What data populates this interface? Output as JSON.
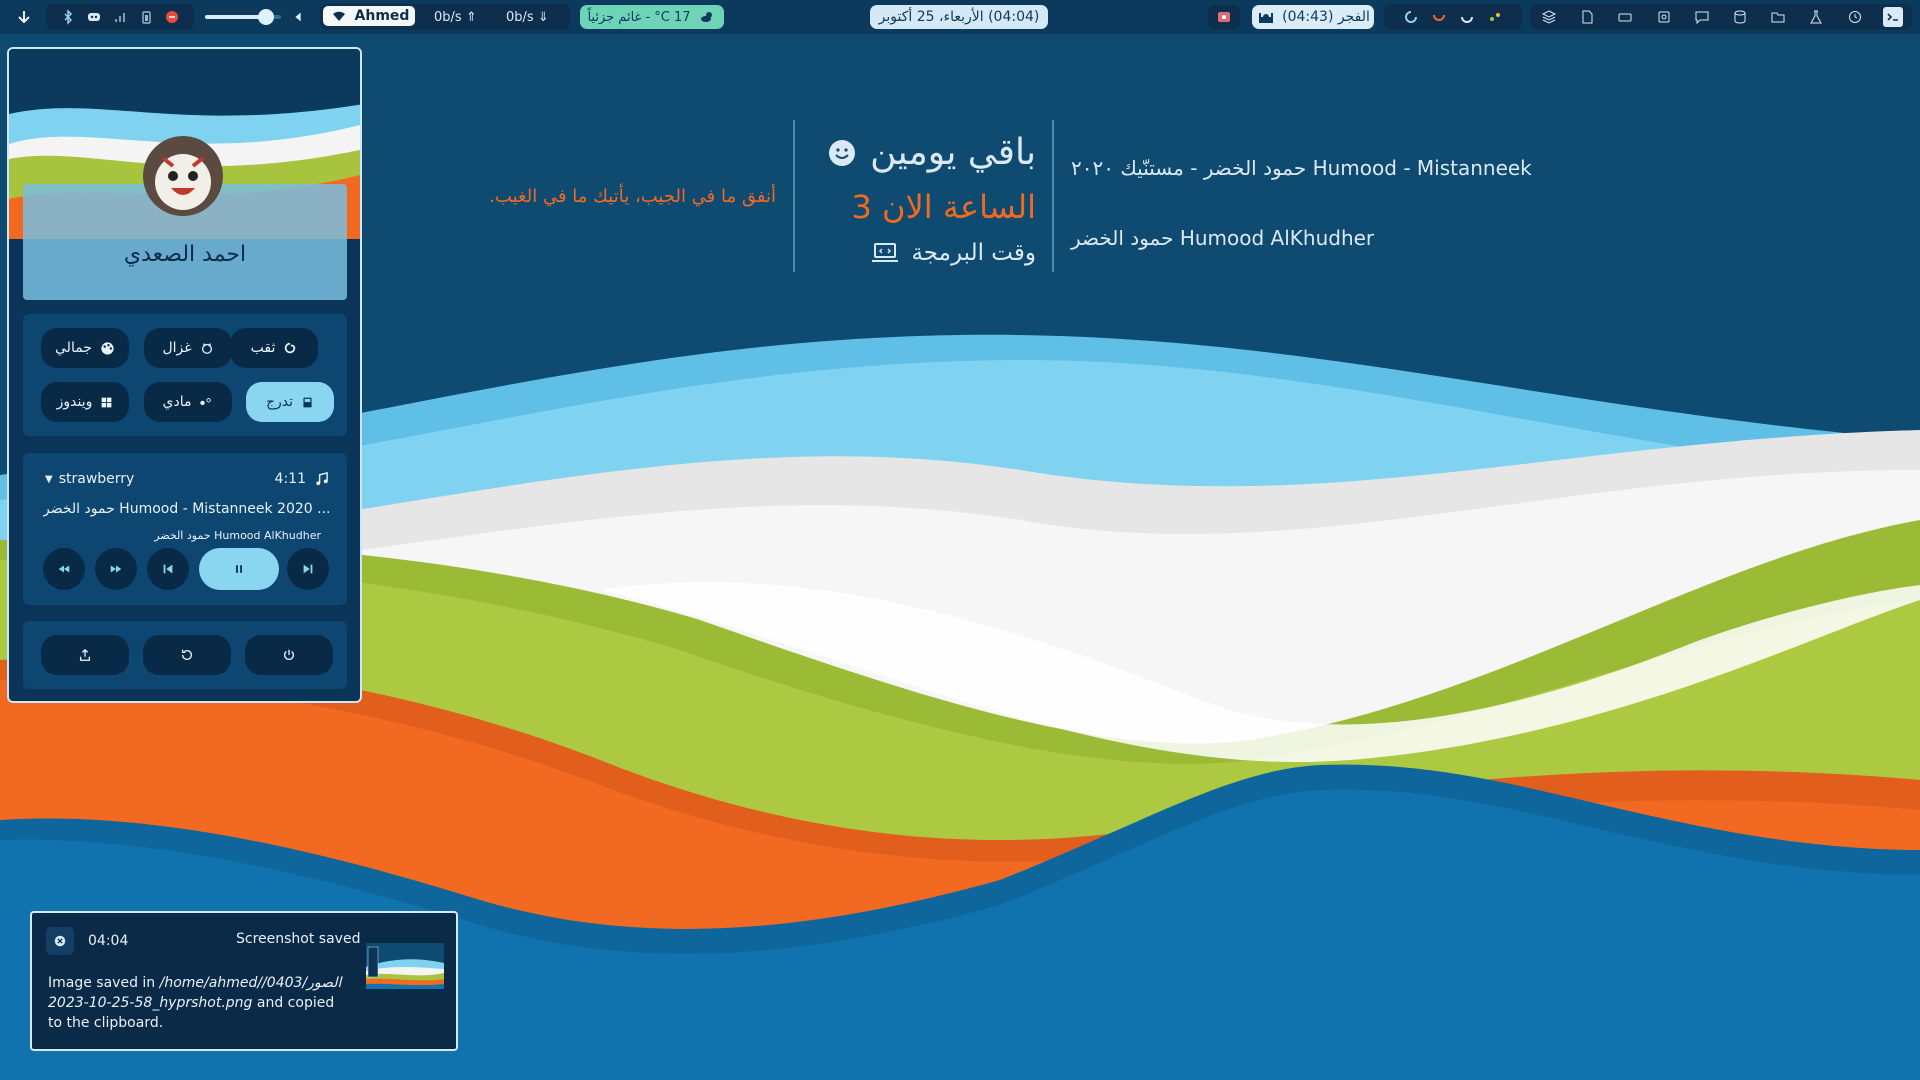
{
  "topbar": {
    "volume_level": 0.8,
    "network": {
      "ssid": "Ahmed",
      "upload": "0b/s",
      "download": "0b/s"
    },
    "weather": {
      "text": "17 C° - غائم جزئياً",
      "icon": "cloud-sun-icon"
    },
    "clock": "(04:04) الأربعاء، 25 أكتوبر",
    "prayer": "الفجر (04:43)",
    "colors": {
      "bar": "#0b3a5c",
      "group": "#0d2e4c",
      "weather_bg": "#6fd3b8",
      "clock_bg": "#d4e8f6",
      "prayer_bg": "#d9ecf8",
      "active_ws": "#8fd3ef"
    }
  },
  "desktop": {
    "quote": "أنفق ما في الجيب، يأتيك ما في الغيب.",
    "countdown": "باقي يومين",
    "hour_now": "الساعة الان 3",
    "activity": "وقت البرمجة",
    "track_title": "حمود الخضر - مستنّيك ٢٠٢٠ Humood - Mistanneek",
    "track_artist": "حمود الخضر Humood AlKhudher",
    "colors": {
      "quote": "#f26a21",
      "hour": "#f26a21",
      "text": "#dbe9f4"
    }
  },
  "panel": {
    "user_name": "احمد الصعدي",
    "themes": [
      {
        "label": "ثقب",
        "icon": "swirl-icon"
      },
      {
        "label": "غزال",
        "icon": "deer-icon"
      },
      {
        "label": "جمالي",
        "icon": "palette-icon"
      },
      {
        "label": "تدرج",
        "icon": "gradient-icon",
        "active": true
      },
      {
        "label": "مادي",
        "icon": "material-icon"
      },
      {
        "label": "ويندوز",
        "icon": "windows-icon"
      }
    ],
    "player": {
      "source": "strawberry",
      "duration": "4:11",
      "title": "حمود الخضر  Humood - Mistanneek 2020 ...",
      "artist": "حمود الخضر Humood AlKhudher"
    }
  },
  "notification": {
    "time": "04:04",
    "title": "Screenshot saved",
    "body_prefix": "Image saved in",
    "body_path": "/home/ahmed//الصور/040358-25-10-2023_hyprshot.png",
    "body_suffix": "and copied to the clipboard."
  },
  "wallpaper_colors": {
    "sky": "#0f4a70",
    "light_blue": "#7fd1ef",
    "white": "#f4f4f4",
    "green": "#a8c43e",
    "orange": "#f26a21",
    "blue": "#0f6fa8"
  }
}
